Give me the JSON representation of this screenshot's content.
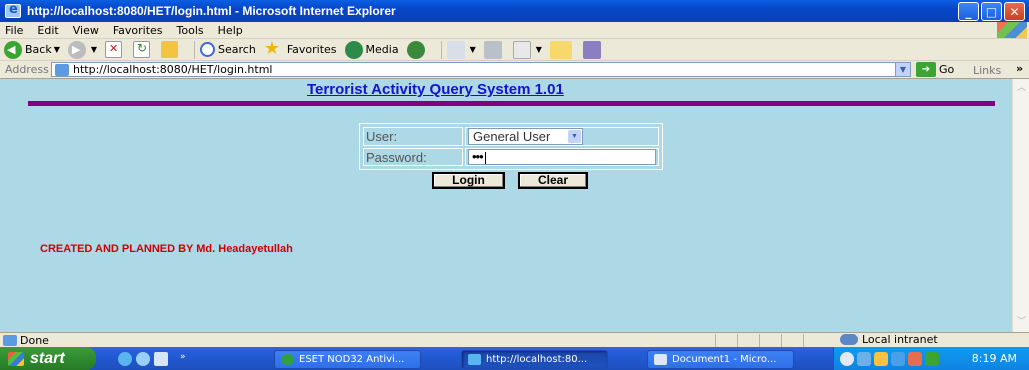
{
  "window": {
    "title": "http://localhost:8080/HET/login.html - Microsoft Internet Explorer"
  },
  "menu": [
    "File",
    "Edit",
    "View",
    "Favorites",
    "Tools",
    "Help"
  ],
  "toolbar": {
    "back": "Back",
    "search": "Search",
    "favorites": "Favorites",
    "media": "Media",
    "go": "Go",
    "links": "Links"
  },
  "address": {
    "label": "Address",
    "url": "http://localhost:8080/HET/login.html"
  },
  "page": {
    "title": "Terrorist Activity Query System 1.01",
    "user_label": "User:",
    "user_value": "General User",
    "password_label": "Password:",
    "password_value": "•••",
    "login_button": "Login",
    "clear_button": "Clear",
    "credit": "CREATED AND PLANNED BY Md. Headayetullah"
  },
  "status": {
    "text": "Done",
    "zone": "Local intranet"
  },
  "taskbar": {
    "start": "start",
    "tasks": [
      "ESET NOD32 Antivi...",
      "http://localhost:80...",
      "Document1 - Micro..."
    ],
    "clock": "8:19 AM"
  },
  "colors": {
    "page_bg": "#add8e6",
    "title_color": "#1414c8",
    "rule_color": "#800080",
    "credit_color": "#d20000"
  }
}
